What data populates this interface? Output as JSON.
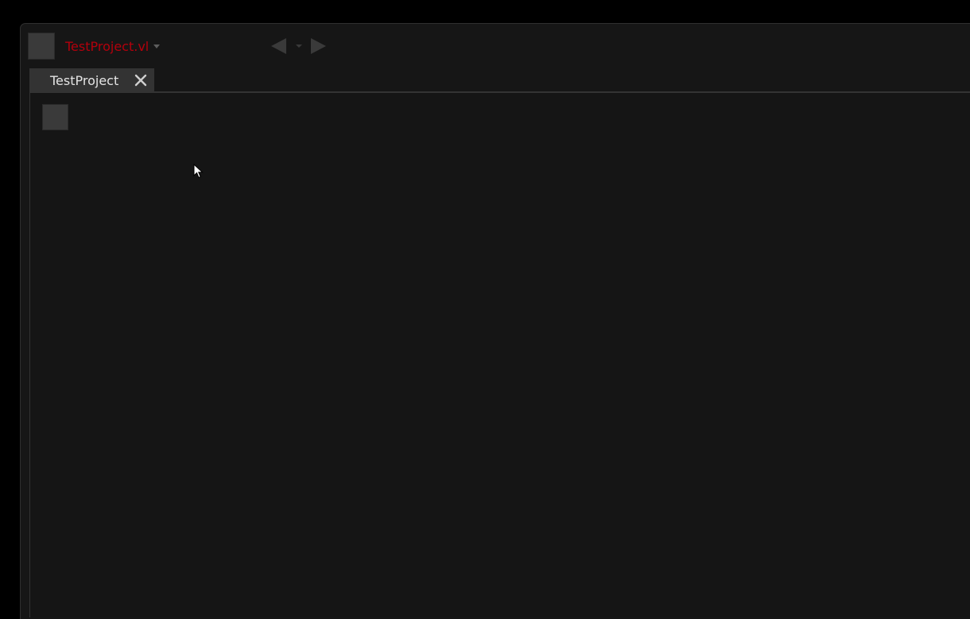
{
  "document": {
    "title": "TestProject.vl"
  },
  "tabs": [
    {
      "label": "TestProject",
      "active": true
    }
  ],
  "icons": {
    "menu": "menu-square-icon",
    "dropdown": "chevron-down-icon",
    "back": "nav-back-icon",
    "history": "nav-history-chevron-icon",
    "forward": "nav-forward-icon",
    "close": "close-icon",
    "patch": "patch-square-icon",
    "cursor": "mouse-cursor-icon"
  },
  "colors": {
    "accent": "#b3000c",
    "background": "#161616",
    "tab": "#333333",
    "control": "#3a3a3a"
  }
}
